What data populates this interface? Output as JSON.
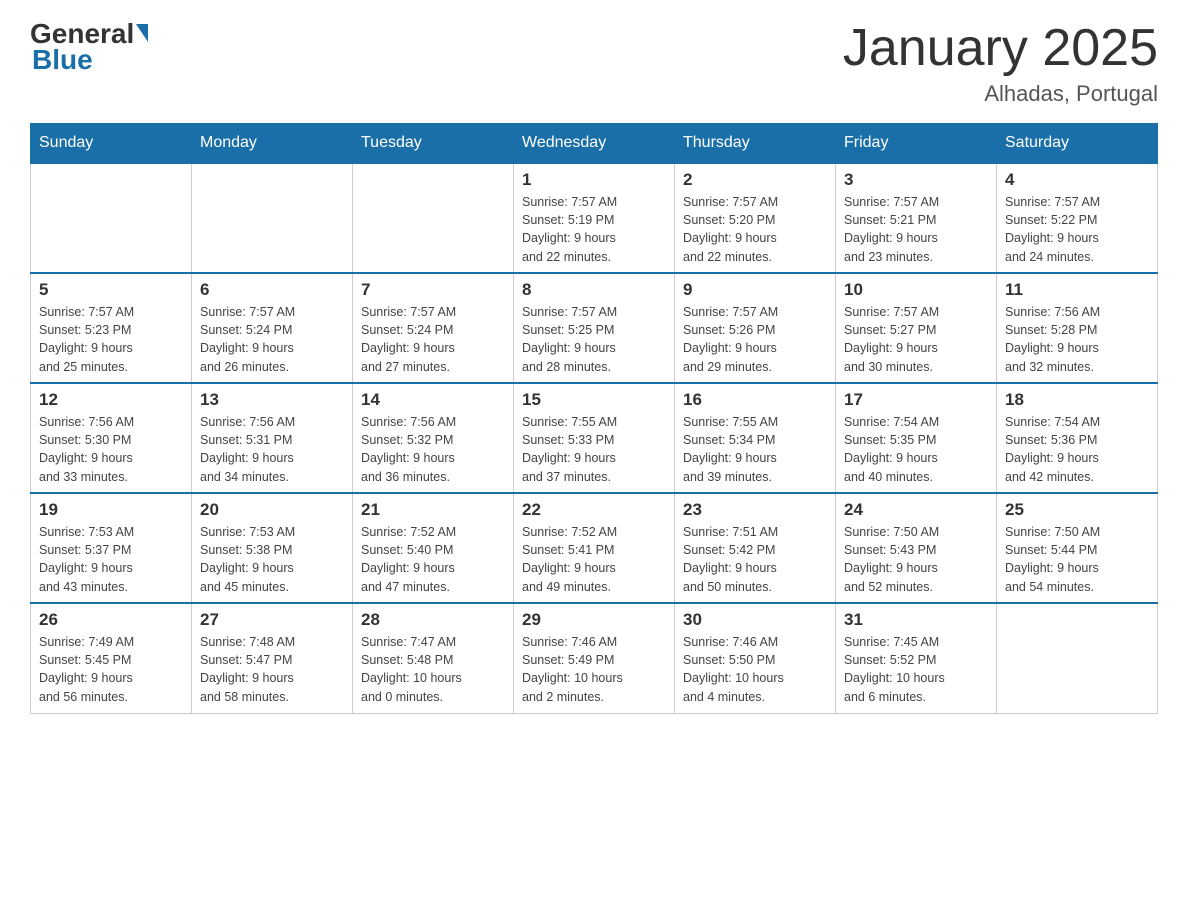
{
  "header": {
    "logo_general": "General",
    "logo_blue": "Blue",
    "title": "January 2025",
    "subtitle": "Alhadas, Portugal"
  },
  "days_of_week": [
    "Sunday",
    "Monday",
    "Tuesday",
    "Wednesday",
    "Thursday",
    "Friday",
    "Saturday"
  ],
  "weeks": [
    [
      {
        "day": "",
        "info": ""
      },
      {
        "day": "",
        "info": ""
      },
      {
        "day": "",
        "info": ""
      },
      {
        "day": "1",
        "info": "Sunrise: 7:57 AM\nSunset: 5:19 PM\nDaylight: 9 hours\nand 22 minutes."
      },
      {
        "day": "2",
        "info": "Sunrise: 7:57 AM\nSunset: 5:20 PM\nDaylight: 9 hours\nand 22 minutes."
      },
      {
        "day": "3",
        "info": "Sunrise: 7:57 AM\nSunset: 5:21 PM\nDaylight: 9 hours\nand 23 minutes."
      },
      {
        "day": "4",
        "info": "Sunrise: 7:57 AM\nSunset: 5:22 PM\nDaylight: 9 hours\nand 24 minutes."
      }
    ],
    [
      {
        "day": "5",
        "info": "Sunrise: 7:57 AM\nSunset: 5:23 PM\nDaylight: 9 hours\nand 25 minutes."
      },
      {
        "day": "6",
        "info": "Sunrise: 7:57 AM\nSunset: 5:24 PM\nDaylight: 9 hours\nand 26 minutes."
      },
      {
        "day": "7",
        "info": "Sunrise: 7:57 AM\nSunset: 5:24 PM\nDaylight: 9 hours\nand 27 minutes."
      },
      {
        "day": "8",
        "info": "Sunrise: 7:57 AM\nSunset: 5:25 PM\nDaylight: 9 hours\nand 28 minutes."
      },
      {
        "day": "9",
        "info": "Sunrise: 7:57 AM\nSunset: 5:26 PM\nDaylight: 9 hours\nand 29 minutes."
      },
      {
        "day": "10",
        "info": "Sunrise: 7:57 AM\nSunset: 5:27 PM\nDaylight: 9 hours\nand 30 minutes."
      },
      {
        "day": "11",
        "info": "Sunrise: 7:56 AM\nSunset: 5:28 PM\nDaylight: 9 hours\nand 32 minutes."
      }
    ],
    [
      {
        "day": "12",
        "info": "Sunrise: 7:56 AM\nSunset: 5:30 PM\nDaylight: 9 hours\nand 33 minutes."
      },
      {
        "day": "13",
        "info": "Sunrise: 7:56 AM\nSunset: 5:31 PM\nDaylight: 9 hours\nand 34 minutes."
      },
      {
        "day": "14",
        "info": "Sunrise: 7:56 AM\nSunset: 5:32 PM\nDaylight: 9 hours\nand 36 minutes."
      },
      {
        "day": "15",
        "info": "Sunrise: 7:55 AM\nSunset: 5:33 PM\nDaylight: 9 hours\nand 37 minutes."
      },
      {
        "day": "16",
        "info": "Sunrise: 7:55 AM\nSunset: 5:34 PM\nDaylight: 9 hours\nand 39 minutes."
      },
      {
        "day": "17",
        "info": "Sunrise: 7:54 AM\nSunset: 5:35 PM\nDaylight: 9 hours\nand 40 minutes."
      },
      {
        "day": "18",
        "info": "Sunrise: 7:54 AM\nSunset: 5:36 PM\nDaylight: 9 hours\nand 42 minutes."
      }
    ],
    [
      {
        "day": "19",
        "info": "Sunrise: 7:53 AM\nSunset: 5:37 PM\nDaylight: 9 hours\nand 43 minutes."
      },
      {
        "day": "20",
        "info": "Sunrise: 7:53 AM\nSunset: 5:38 PM\nDaylight: 9 hours\nand 45 minutes."
      },
      {
        "day": "21",
        "info": "Sunrise: 7:52 AM\nSunset: 5:40 PM\nDaylight: 9 hours\nand 47 minutes."
      },
      {
        "day": "22",
        "info": "Sunrise: 7:52 AM\nSunset: 5:41 PM\nDaylight: 9 hours\nand 49 minutes."
      },
      {
        "day": "23",
        "info": "Sunrise: 7:51 AM\nSunset: 5:42 PM\nDaylight: 9 hours\nand 50 minutes."
      },
      {
        "day": "24",
        "info": "Sunrise: 7:50 AM\nSunset: 5:43 PM\nDaylight: 9 hours\nand 52 minutes."
      },
      {
        "day": "25",
        "info": "Sunrise: 7:50 AM\nSunset: 5:44 PM\nDaylight: 9 hours\nand 54 minutes."
      }
    ],
    [
      {
        "day": "26",
        "info": "Sunrise: 7:49 AM\nSunset: 5:45 PM\nDaylight: 9 hours\nand 56 minutes."
      },
      {
        "day": "27",
        "info": "Sunrise: 7:48 AM\nSunset: 5:47 PM\nDaylight: 9 hours\nand 58 minutes."
      },
      {
        "day": "28",
        "info": "Sunrise: 7:47 AM\nSunset: 5:48 PM\nDaylight: 10 hours\nand 0 minutes."
      },
      {
        "day": "29",
        "info": "Sunrise: 7:46 AM\nSunset: 5:49 PM\nDaylight: 10 hours\nand 2 minutes."
      },
      {
        "day": "30",
        "info": "Sunrise: 7:46 AM\nSunset: 5:50 PM\nDaylight: 10 hours\nand 4 minutes."
      },
      {
        "day": "31",
        "info": "Sunrise: 7:45 AM\nSunset: 5:52 PM\nDaylight: 10 hours\nand 6 minutes."
      },
      {
        "day": "",
        "info": ""
      }
    ]
  ]
}
